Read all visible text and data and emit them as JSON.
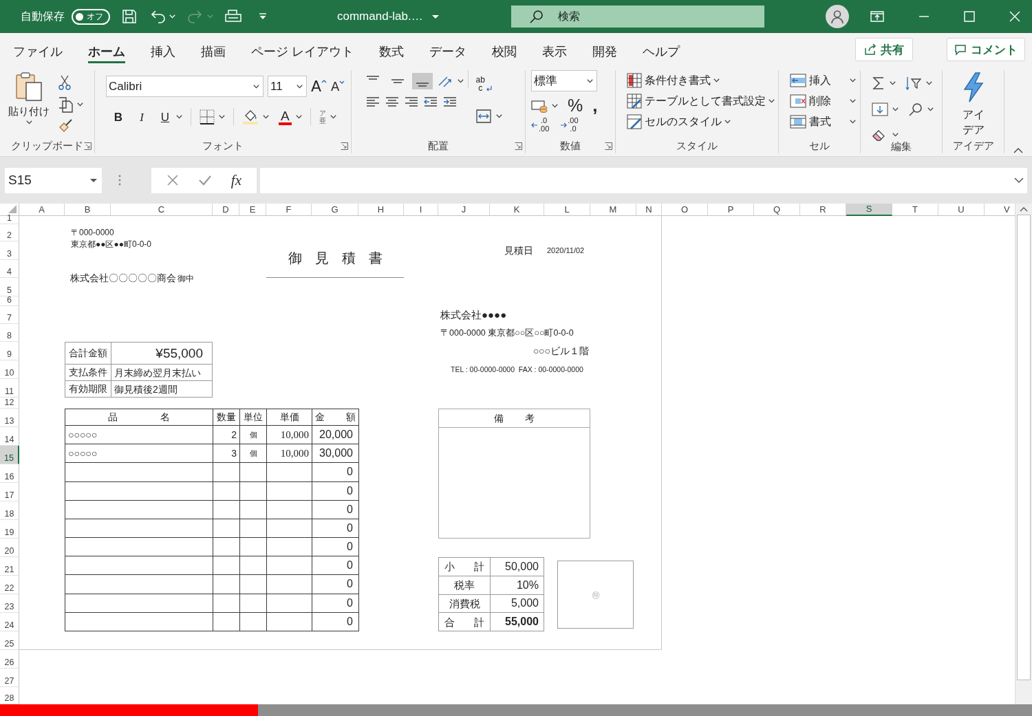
{
  "title_bar": {
    "autosave_label": "自動保存",
    "autosave": {
      "label": "オフ",
      "on": false
    },
    "redo_disabled": true,
    "file_name": "command-lab.…",
    "search": {
      "placeholder": "検索"
    }
  },
  "tabs": [
    {
      "label": "ファイル",
      "selected": false
    },
    {
      "label": "ホーム",
      "selected": true
    },
    {
      "label": "挿入",
      "selected": false
    },
    {
      "label": "描画",
      "selected": false
    },
    {
      "label": "ページ レイアウト",
      "selected": false
    },
    {
      "label": "数式",
      "selected": false
    },
    {
      "label": "データ",
      "selected": false
    },
    {
      "label": "校閲",
      "selected": false
    },
    {
      "label": "表示",
      "selected": false
    },
    {
      "label": "開発",
      "selected": false
    },
    {
      "label": "ヘルプ",
      "selected": false
    }
  ],
  "share_button": "共有",
  "comment_button": "コメント",
  "ribbon": {
    "clipboard": {
      "paste": "貼り付け",
      "label": "クリップボード"
    },
    "font": {
      "name": "Calibri",
      "size": "11",
      "grow": "A",
      "shrink": "A",
      "bold": "B",
      "italic": "I",
      "underline": "U",
      "font_color": "A",
      "phonetic": "ア亜",
      "label": "フォント"
    },
    "alignment": {
      "vertical": [
        {
          "selected": false
        },
        {
          "selected": false
        },
        {
          "selected": true
        }
      ],
      "wrap": "abc",
      "label": "配置"
    },
    "number": {
      "format": "標準",
      "percent": "%",
      "comma": ",",
      "increase_decimal": [
        ".0",
        ".00"
      ],
      "decrease_decimal": [
        ".00",
        ".0"
      ],
      "label": "数値"
    },
    "styles": {
      "items": [
        "条件付き書式",
        "テーブルとして書式設定",
        "セルのスタイル"
      ],
      "label": "スタイル"
    },
    "cells": {
      "items": [
        "挿入",
        "削除",
        "書式"
      ],
      "label": "セル"
    },
    "editing": {
      "label": "編集"
    },
    "ideas": {
      "button": "アイデア",
      "label": "アイデア"
    }
  },
  "formula_bar": {
    "name_box": "S15",
    "fx": "fx"
  },
  "sheet": {
    "columns": [
      {
        "label": "A",
        "selected": false
      },
      {
        "label": "B",
        "selected": false
      },
      {
        "label": "C",
        "selected": false
      },
      {
        "label": "D",
        "selected": false
      },
      {
        "label": "E",
        "selected": false
      },
      {
        "label": "F",
        "selected": false
      },
      {
        "label": "G",
        "selected": false
      },
      {
        "label": "H",
        "selected": false
      },
      {
        "label": "I",
        "selected": false
      },
      {
        "label": "J",
        "selected": false
      },
      {
        "label": "K",
        "selected": false
      },
      {
        "label": "L",
        "selected": false
      },
      {
        "label": "M",
        "selected": false
      },
      {
        "label": "N",
        "selected": false
      },
      {
        "label": "O",
        "selected": false
      },
      {
        "label": "P",
        "selected": false
      },
      {
        "label": "Q",
        "selected": false
      },
      {
        "label": "R",
        "selected": false
      },
      {
        "label": "S",
        "selected": true
      },
      {
        "label": "T",
        "selected": false
      },
      {
        "label": "U",
        "selected": false
      },
      {
        "label": "V",
        "selected": false
      }
    ],
    "rows": [
      {
        "label": "1",
        "selected": false
      },
      {
        "label": "2",
        "selected": false
      },
      {
        "label": "3",
        "selected": false
      },
      {
        "label": "4",
        "selected": false
      },
      {
        "label": "5",
        "selected": false
      },
      {
        "label": "6",
        "selected": false
      },
      {
        "label": "7",
        "selected": false
      },
      {
        "label": "8",
        "selected": false
      },
      {
        "label": "9",
        "selected": false
      },
      {
        "label": "10",
        "selected": false
      },
      {
        "label": "11",
        "selected": false
      },
      {
        "label": "12",
        "selected": false
      },
      {
        "label": "13",
        "selected": false
      },
      {
        "label": "14",
        "selected": false
      },
      {
        "label": "15",
        "selected": true
      },
      {
        "label": "16",
        "selected": false
      },
      {
        "label": "17",
        "selected": false
      },
      {
        "label": "18",
        "selected": false
      },
      {
        "label": "19",
        "selected": false
      },
      {
        "label": "20",
        "selected": false
      },
      {
        "label": "21",
        "selected": false
      },
      {
        "label": "22",
        "selected": false
      },
      {
        "label": "23",
        "selected": false
      },
      {
        "label": "24",
        "selected": false
      },
      {
        "label": "25",
        "selected": false
      },
      {
        "label": "26",
        "selected": false
      },
      {
        "label": "27",
        "selected": false
      },
      {
        "label": "28",
        "selected": false
      }
    ]
  },
  "document": {
    "sender": {
      "postal": "〒000-0000",
      "address": "東京都●●区●●町0-0-0"
    },
    "title": "御見積書",
    "recipient": {
      "name": "株式会社〇〇〇〇〇商会",
      "honorific": "御中"
    },
    "date_label": "見積日",
    "date": "2020/11/02",
    "issuer": {
      "company": "株式会社●●●●",
      "address": "〒000-0000 東京都○○区○○町0-0-0",
      "building": "○○○ビル１階",
      "contact": "TEL : 00-0000-0000  FAX : 00-0000-0000"
    },
    "summary": [
      {
        "label": "合計金額",
        "value": "¥55,000"
      },
      {
        "label": "支払条件",
        "value": "月末締め翌月末払い"
      },
      {
        "label": "有効期限",
        "value": "御見積後2週間"
      }
    ],
    "items": {
      "columns": [
        {
          "label": "品名",
          "kind": "distributed"
        },
        {
          "label": "数量",
          "kind": "centered"
        },
        {
          "label": "単位",
          "kind": "centered"
        },
        {
          "label": "単価",
          "kind": "centered"
        },
        {
          "label": "金額",
          "kind": "distributed"
        }
      ],
      "rows": [
        {
          "name": "○○○○○",
          "qty": "2",
          "unit": "個",
          "price": "10,000",
          "amount": "20,000"
        },
        {
          "name": "○○○○○",
          "qty": "3",
          "unit": "個",
          "price": "10,000",
          "amount": "30,000"
        },
        {
          "amount": "0"
        },
        {
          "amount": "0"
        },
        {
          "amount": "0"
        },
        {
          "amount": "0"
        },
        {
          "amount": "0"
        },
        {
          "amount": "0"
        },
        {
          "amount": "0"
        },
        {
          "amount": "0"
        },
        {
          "amount": "0"
        }
      ]
    },
    "remarks": {
      "header": "備考"
    },
    "totals": [
      {
        "label": "小計",
        "kind": "distributed",
        "value": "50,000",
        "bold": false
      },
      {
        "label": "税率",
        "kind": "centered",
        "value": "10%",
        "bold": false
      },
      {
        "label": "消費税",
        "kind": "centered",
        "value": "5,000",
        "bold": false
      },
      {
        "label": "合計",
        "kind": "distributed",
        "value": "55,000",
        "bold": true
      }
    ],
    "stamp": "㊞"
  },
  "progress": {
    "level": 0.25
  }
}
